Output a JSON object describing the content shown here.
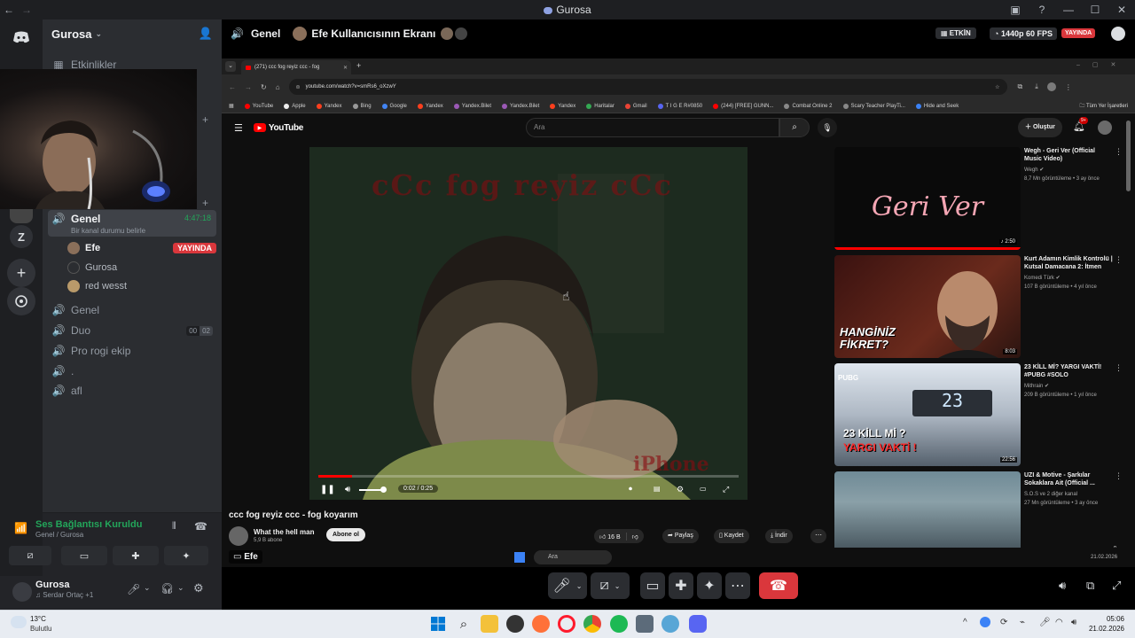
{
  "window": {
    "title": "Gurosa"
  },
  "server": {
    "name": "Gurosa"
  },
  "sidebar": {
    "events_label": "Etkinlikler",
    "active_channel": {
      "name": "Genel",
      "timer": "4:47:18",
      "status": "Bir kanal durumu belirle"
    },
    "voice_users": [
      {
        "name": "Efe",
        "badge": "YAYINDA"
      },
      {
        "name": "Gurosa"
      },
      {
        "name": "red wesst"
      }
    ],
    "channels": [
      {
        "name": "Genel"
      },
      {
        "name": "Duo",
        "count_a": "00",
        "count_b": "02"
      },
      {
        "name": "Pro rogi ekip"
      },
      {
        "name": "."
      },
      {
        "name": "afl"
      }
    ]
  },
  "voice_panel": {
    "status": "Ses Bağlantısı Kuruldu",
    "location": "Genel / Gurosa"
  },
  "user_panel": {
    "name": "Gurosa",
    "activity": "♫ Serdar Ortaç +1"
  },
  "stream_header": {
    "channel": "Genel",
    "screen_title": "Efe Kullanıcısının Ekranı",
    "active_label": "ETKİN",
    "quality": "1440p 60 FPS",
    "live": "YAYINDA"
  },
  "browser": {
    "tab_title": "(271) ccc fog reyiz ccc - fog",
    "url": "youtube.com/watch?v=smRs6_oXzwY",
    "bookmarks": [
      "YouTube",
      "Apple",
      "Yandex",
      "Bing",
      "Google",
      "Yandex",
      "Yandex.Bilet",
      "Yandex.Bilet",
      "Yandex",
      "Haritalar",
      "Gmail",
      "T I G E R#0850",
      "(244) [FREE] GUNN...",
      "Combat Online 2",
      "Scary Teacher PlayTi...",
      "Hide and Seek"
    ],
    "all_bookmarks": "Tüm Yer İşaretleri"
  },
  "youtube": {
    "logo": "YouTube",
    "search_placeholder": "Ara",
    "create_label": "Oluştur",
    "notif_count": "9+",
    "video": {
      "overlay_title": "cCc fog reyiz cCc",
      "watermark": "iPhone",
      "time": "0:02 / 0:25",
      "progress": 0.08,
      "title": "ccc fog reyiz ccc - fog koyarım",
      "channel": "What the hell man",
      "subs": "5,9 B abone",
      "subscribe": "Abone ol",
      "likes": "16 B",
      "share": "Paylaş",
      "save": "Kaydet",
      "download": "İndir"
    },
    "recommendations": [
      {
        "title": "Wegh - Geri Ver (Official Music Video)",
        "channel": "Wegh",
        "meta": "8,7 Mn görüntüleme • 3 ay önce",
        "duration": "2:50",
        "thumb_text": "Geri Ver"
      },
      {
        "title": "Kurt Adamın Kimlik Kontrolü | Kutsal Damacana 2: İtmen",
        "channel": "Komedi Türk",
        "meta": "107 B görüntüleme • 4 yıl önce",
        "duration": "8:03",
        "thumb_text": "HANGİNİZ FİKRET?"
      },
      {
        "title": "23 KİLL Mİ? YARGI VAKTİ! #PUBG #SOLO",
        "channel": "Mithrain",
        "meta": "209 B görüntüleme • 1 yıl önce",
        "duration": "22:56",
        "thumb_text_a": "23 KİLL Mİ ?",
        "thumb_text_b": "YARGI VAKTİ !",
        "thumb_corner": "PUBG",
        "thumb_counter": "23"
      },
      {
        "title": "UZI & Motive - Şarkılar Sokaklara Ait (Official ...",
        "channel": "S.O.S ve 2 diğer kanal",
        "meta": "27 Mn görüntüleme • 3 ay önce"
      }
    ]
  },
  "streamer_label": "Efe",
  "remote_taskbar": {
    "search": "Ara",
    "date": "21.02.2026"
  },
  "taskbar": {
    "weather_temp": "13°C",
    "weather_desc": "Bulutlu",
    "time": "05:06",
    "date": "21.02.2026"
  },
  "colors": {
    "blurple": "#5865f2",
    "green": "#23a55a",
    "red": "#da373c",
    "yt_red": "#ff0000"
  }
}
